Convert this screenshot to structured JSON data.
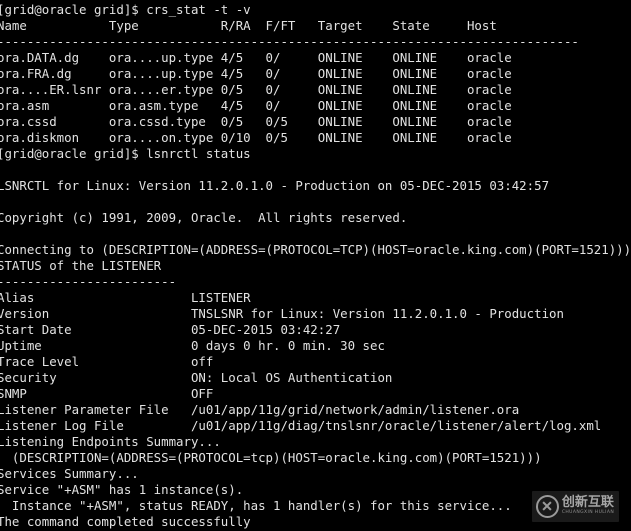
{
  "terminal": {
    "background_color": "#000000",
    "text_color": "#e2e2e2",
    "lines": [
      "[grid@oracle grid]$ crs_stat -t -v",
      "Name           Type           R/RA  F/FT   Target    State     Host",
      "------------------------------------------------------------------------------",
      "ora.DATA.dg    ora....up.type 4/5   0/     ONLINE    ONLINE    oracle",
      "ora.FRA.dg     ora....up.type 4/5   0/     ONLINE    ONLINE    oracle",
      "ora....ER.lsnr ora....er.type 0/5   0/     ONLINE    ONLINE    oracle",
      "ora.asm        ora.asm.type   4/5   0/     ONLINE    ONLINE    oracle",
      "ora.cssd       ora.cssd.type  0/5   0/5    ONLINE    ONLINE    oracle",
      "ora.diskmon    ora....on.type 0/10  0/5    ONLINE    ONLINE    oracle",
      "[grid@oracle grid]$ lsnrctl status",
      "",
      "LSNRCTL for Linux: Version 11.2.0.1.0 - Production on 05-DEC-2015 03:42:57",
      "",
      "Copyright (c) 1991, 2009, Oracle.  All rights reserved.",
      "",
      "Connecting to (DESCRIPTION=(ADDRESS=(PROTOCOL=TCP)(HOST=oracle.king.com)(PORT=1521)))",
      "STATUS of the LISTENER",
      "------------------------",
      "Alias                     LISTENER",
      "Version                   TNSLSNR for Linux: Version 11.2.0.1.0 - Production",
      "Start Date                05-DEC-2015 03:42:27",
      "Uptime                    0 days 0 hr. 0 min. 30 sec",
      "Trace Level               off",
      "Security                  ON: Local OS Authentication",
      "SNMP                      OFF",
      "Listener Parameter File   /u01/app/11g/grid/network/admin/listener.ora",
      "Listener Log File         /u01/app/11g/diag/tnslsnr/oracle/listener/alert/log.xml",
      "Listening Endpoints Summary...",
      "  (DESCRIPTION=(ADDRESS=(PROTOCOL=tcp)(HOST=oracle.king.com)(PORT=1521)))",
      "Services Summary...",
      "Service \"+ASM\" has 1 instance(s).",
      "  Instance \"+ASM\", status READY, has 1 handler(s) for this service...",
      "The command completed successfully"
    ],
    "commands": [
      "crs_stat -t -v",
      "lsnrctl status"
    ],
    "prompt": "[grid@oracle grid]$",
    "crs_stat_table": {
      "headers": [
        "Name",
        "Type",
        "R/RA",
        "F/FT",
        "Target",
        "State",
        "Host"
      ],
      "rows": [
        [
          "ora.DATA.dg",
          "ora....up.type",
          "4/5",
          "0/",
          "ONLINE",
          "ONLINE",
          "oracle"
        ],
        [
          "ora.FRA.dg",
          "ora....up.type",
          "4/5",
          "0/",
          "ONLINE",
          "ONLINE",
          "oracle"
        ],
        [
          "ora....ER.lsnr",
          "ora....er.type",
          "0/5",
          "0/",
          "ONLINE",
          "ONLINE",
          "oracle"
        ],
        [
          "ora.asm",
          "ora.asm.type",
          "4/5",
          "0/",
          "ONLINE",
          "ONLINE",
          "oracle"
        ],
        [
          "ora.cssd",
          "ora.cssd.type",
          "0/5",
          "0/5",
          "ONLINE",
          "ONLINE",
          "oracle"
        ],
        [
          "ora.diskmon",
          "ora....on.type",
          "0/10",
          "0/5",
          "ONLINE",
          "ONLINE",
          "oracle"
        ]
      ]
    },
    "listener_status": {
      "banner": "LSNRCTL for Linux: Version 11.2.0.1.0 - Production on 05-DEC-2015 03:42:57",
      "copyright": "Copyright (c) 1991, 2009, Oracle.  All rights reserved.",
      "connecting": "Connecting to (DESCRIPTION=(ADDRESS=(PROTOCOL=TCP)(HOST=oracle.king.com)(PORT=1521)))",
      "status_header": "STATUS of the LISTENER",
      "fields": [
        {
          "label": "Alias",
          "value": "LISTENER"
        },
        {
          "label": "Version",
          "value": "TNSLSNR for Linux: Version 11.2.0.1.0 - Production"
        },
        {
          "label": "Start Date",
          "value": "05-DEC-2015 03:42:27"
        },
        {
          "label": "Uptime",
          "value": "0 days 0 hr. 0 min. 30 sec"
        },
        {
          "label": "Trace Level",
          "value": "off"
        },
        {
          "label": "Security",
          "value": "ON: Local OS Authentication"
        },
        {
          "label": "SNMP",
          "value": "OFF"
        },
        {
          "label": "Listener Parameter File",
          "value": "/u01/app/11g/grid/network/admin/listener.ora"
        },
        {
          "label": "Listener Log File",
          "value": "/u01/app/11g/diag/tnslsnr/oracle/listener/alert/log.xml"
        }
      ],
      "endpoints_summary_label": "Listening Endpoints Summary...",
      "endpoint": "(DESCRIPTION=(ADDRESS=(PROTOCOL=tcp)(HOST=oracle.king.com)(PORT=1521)))",
      "services_summary_label": "Services Summary...",
      "service": "Service \"+ASM\" has 1 instance(s).",
      "instance": "Instance \"+ASM\", status READY, has 1 handler(s) for this service...",
      "result": "The command completed successfully"
    }
  },
  "watermark": {
    "logo_icon": "circled-x-icon",
    "chinese_text": "创新互联",
    "pinyin_text": "CHUANGXIN HULIAN",
    "color": "#a5a5a5"
  }
}
